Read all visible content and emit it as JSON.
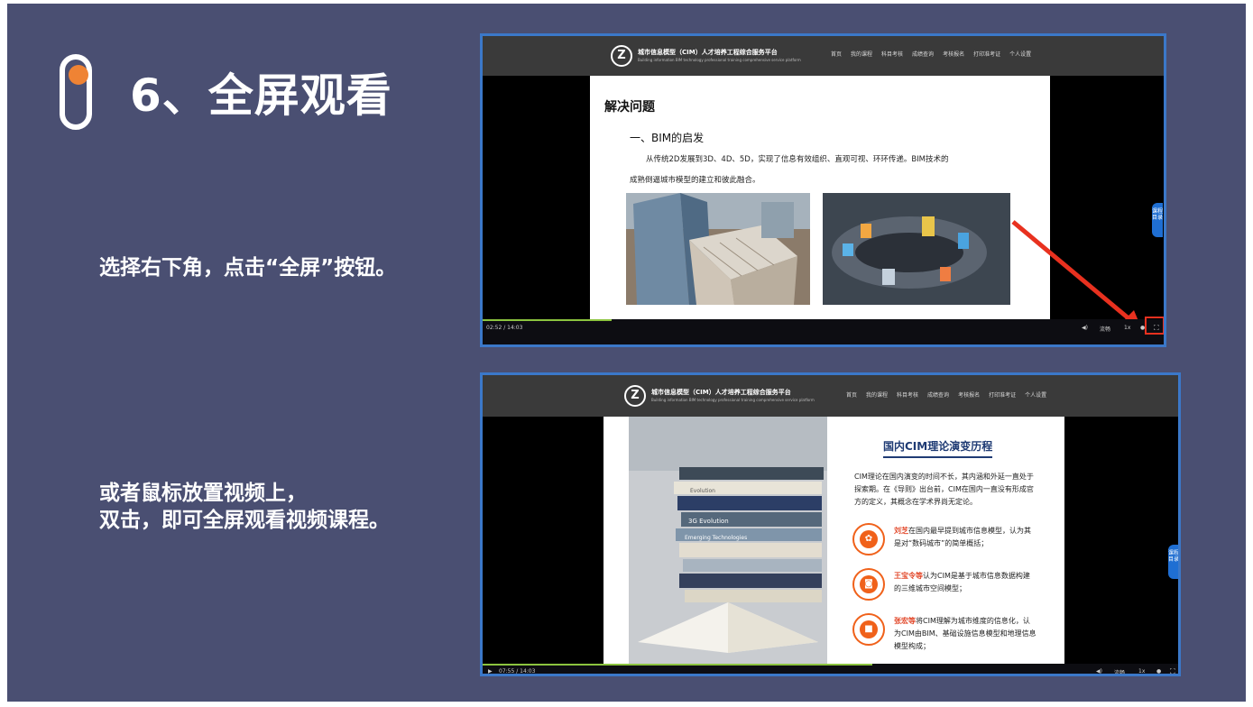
{
  "slide": {
    "step_title": "6、全屏观看",
    "instruction_1": "选择右下角，点击“全屏”按钮。",
    "instruction_2_line1": "或者鼠标放置视频上，",
    "instruction_2_line2": "双击，即可全屏观看视频课程。"
  },
  "colors": {
    "slide_bg": "#4a4f72",
    "accent_orange": "#ef8334",
    "frame_blue": "#3b78c9",
    "arrow_red": "#e8311f",
    "progress_green": "#8cc43f"
  },
  "site": {
    "logo_letter": "Z",
    "name": "城市信息模型（CIM）人才培养工程综合服务平台",
    "subtitle": "Building information BIM technology professional training comprehensive service platform",
    "nav": [
      "首页",
      "我的课程",
      "科目考核",
      "成绩查询",
      "考核报名",
      "打印准考证",
      "个人设置"
    ]
  },
  "video1": {
    "doc_heading": "解决问题",
    "doc_subheading": "一、BIM的启发",
    "doc_para_line1": "从传统2D发展到3D、4D、5D，实现了信息有效组织、直观可视、环环传递。BIM技术的",
    "doc_para_line2": "成熟倒逼城市模型的建立和彼此融合。",
    "time": "02:52 / 14:03",
    "volume_icon": "volume-icon",
    "quality": "流畅",
    "speed": "1x",
    "fullscreen_icon": "fullscreen-icon",
    "side_tab": "课程目录",
    "progress_fraction": 0.19
  },
  "video2": {
    "doc_title": "国内CIM理论演变历程",
    "intro": "CIM理论在国内演变的时间不长，其内涵和外延一直处于探索期。在《导则》出台前，CIM在国内一直没有形成官方的定义，其概念在学术界尚无定论。",
    "items": [
      {
        "name": "刘芝",
        "text": "在国内最早提到城市信息模型，认为其是对“数码城市”的简单概括；",
        "icon": "aperture-icon"
      },
      {
        "name": "王宝令等",
        "text": "认为CIM是基于城市信息数据构建的三维城市空间模型；",
        "icon": "camera-icon"
      },
      {
        "name": "张宏等",
        "text": "将CIM理解为城市维度的信息化，认为CIM由BIM、基础设施信息模型和地理信息模型构成；",
        "icon": "lock-icon"
      }
    ],
    "book_titles": [
      "Evolution",
      "Emerging Technologies",
      "3G Evolution"
    ],
    "play_icon": "play-icon",
    "time": "07:55 / 14:03",
    "quality": "流畅",
    "speed": "1x",
    "settings_icon": "gear-icon",
    "fullscreen_icon": "fullscreen-icon",
    "side_tab": "课程目录",
    "progress_fraction": 0.56
  }
}
